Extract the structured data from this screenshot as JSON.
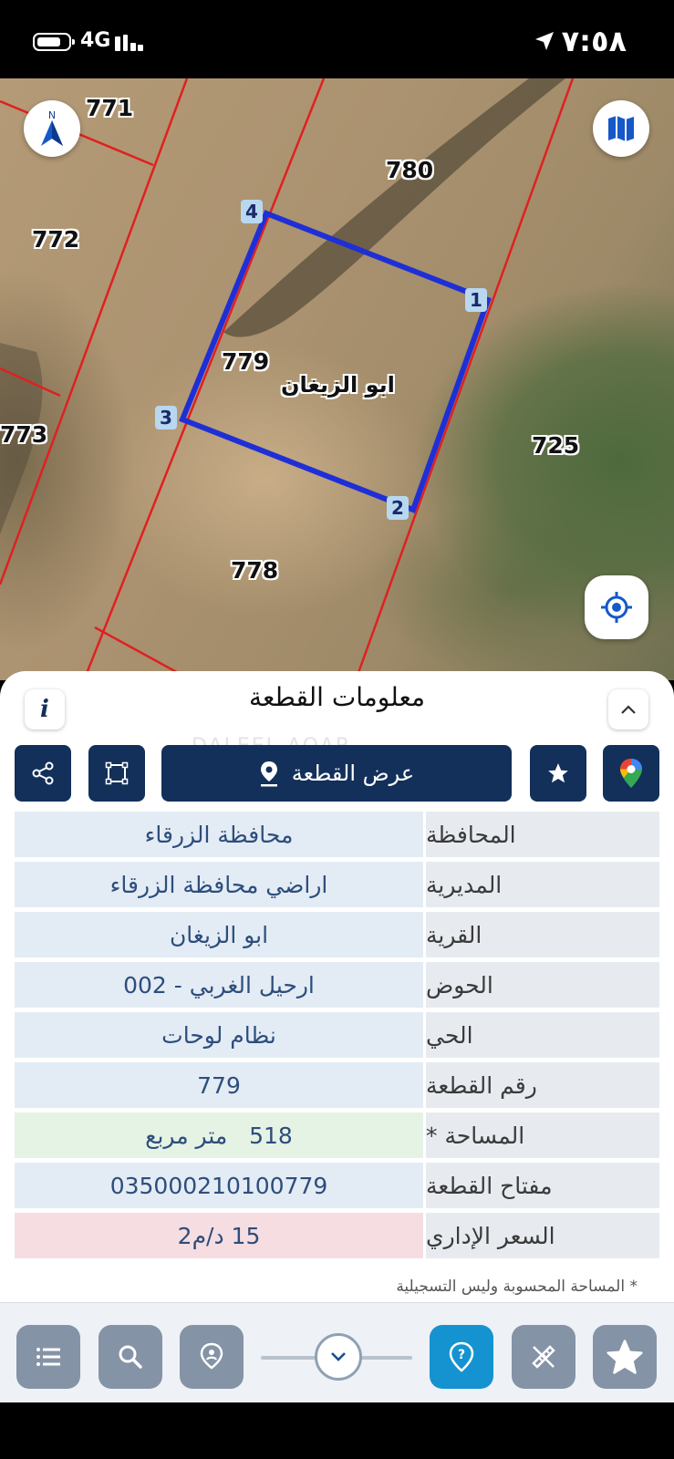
{
  "status_bar": {
    "network": "4G",
    "time": "٧:٥٨"
  },
  "map": {
    "plots": {
      "p771": "771",
      "p772": "772",
      "p773": "773",
      "p778": "778",
      "p779": "779",
      "p780": "780",
      "p725": "725"
    },
    "vertices": [
      "1",
      "2",
      "3",
      "4"
    ],
    "village_label": "ابو الزيغان",
    "compass_letter": "N",
    "colors": {
      "parcel_outline": "#1f2fd6",
      "boundary": "#e02020"
    }
  },
  "panel": {
    "title": "معلومات القطعة",
    "info_label": "i",
    "watermark": "DALEEL AQAR",
    "show_plot_button": "عرض القطعة",
    "rows": [
      {
        "label": "المحافظة",
        "value": "محافظة الزرقاء"
      },
      {
        "label": "المديرية",
        "value": "اراضي محافظة الزرقاء"
      },
      {
        "label": "القرية",
        "value": "ابو الزيغان"
      },
      {
        "label": "الحوض",
        "value": "ارحيل الغربي - 002"
      },
      {
        "label": "الحي",
        "value": "نظام لوحات"
      },
      {
        "label": "رقم القطعة",
        "value": "779"
      },
      {
        "label": "المساحة *",
        "value": "518   متر مربع"
      },
      {
        "label": "مفتاح القطعة",
        "value": "035000210100779"
      },
      {
        "label": "السعر الإداري",
        "value": "15 د/م2"
      }
    ],
    "footnote": "* المساحة المحسوبة وليس التسجيلية"
  },
  "bottom_bar": {
    "icons": [
      "list-icon",
      "search-icon",
      "location-pin-icon",
      "chevron-down-icon",
      "help-icon",
      "measure-icon",
      "favorite-star-icon"
    ]
  }
}
